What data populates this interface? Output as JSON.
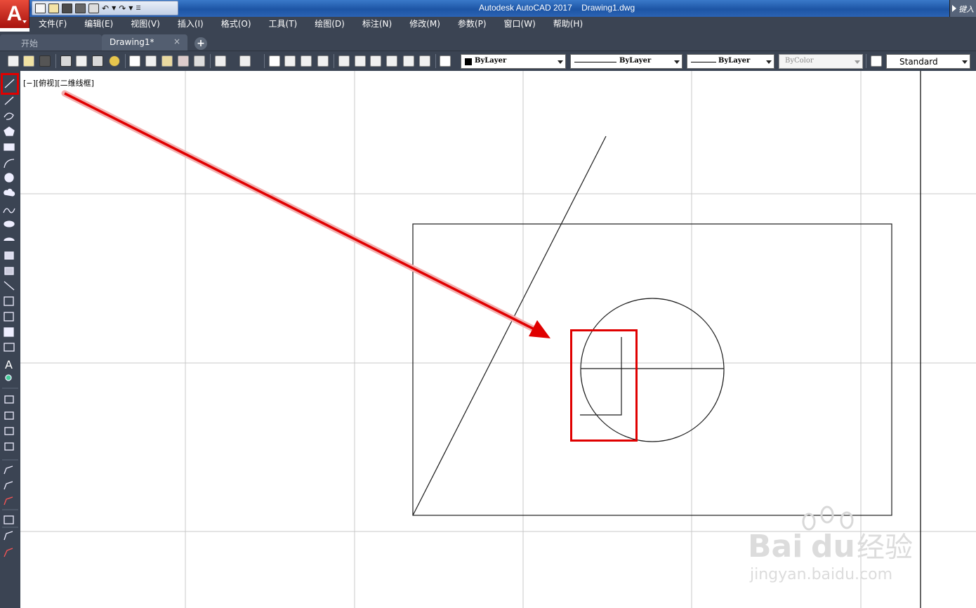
{
  "title_bar": {
    "app_title": "Autodesk AutoCAD 2017    Drawing1.dwg",
    "search_stub_text": "键入"
  },
  "menu": [
    "文件(F)",
    "编辑(E)",
    "视图(V)",
    "插入(I)",
    "格式(O)",
    "工具(T)",
    "绘图(D)",
    "标注(N)",
    "修改(M)",
    "参数(P)",
    "窗口(W)",
    "帮助(H)"
  ],
  "tabs": {
    "start": "开始",
    "drawing": "Drawing1*",
    "close_glyph": "×",
    "add_glyph": "+"
  },
  "toolbar": {
    "color_combo": "ByLayer",
    "linetype_combo": "ByLayer",
    "lineweight_combo": "ByLayer",
    "plotstyle_combo": "ByColor",
    "textstyle_combo": "Standard"
  },
  "viewport": {
    "label": "[−][俯视][二维线框]"
  },
  "left_tools": [
    "line",
    "construction-line",
    "polyline",
    "polygon",
    "rectangle",
    "arc",
    "circle",
    "revision-cloud",
    "spline",
    "ellipse",
    "ellipse-arc",
    "insert-block",
    "make-block",
    "point",
    "hatch",
    "gradient",
    "region",
    "table",
    "multiline-text",
    "add-selected"
  ],
  "annotations": {
    "highlight_color": "#e00000",
    "arrow_color": "#e00000"
  },
  "watermark": {
    "brand_text": "Bai",
    "brand_text2": "du",
    "brand_cn": "经验",
    "url": "jingyan.baidu.com"
  },
  "colors": {
    "chrome_dark": "#3b4453",
    "title_blue": "#2a62b0",
    "logo_red": "#c8201a",
    "grid_gray": "#c9c9c9"
  }
}
